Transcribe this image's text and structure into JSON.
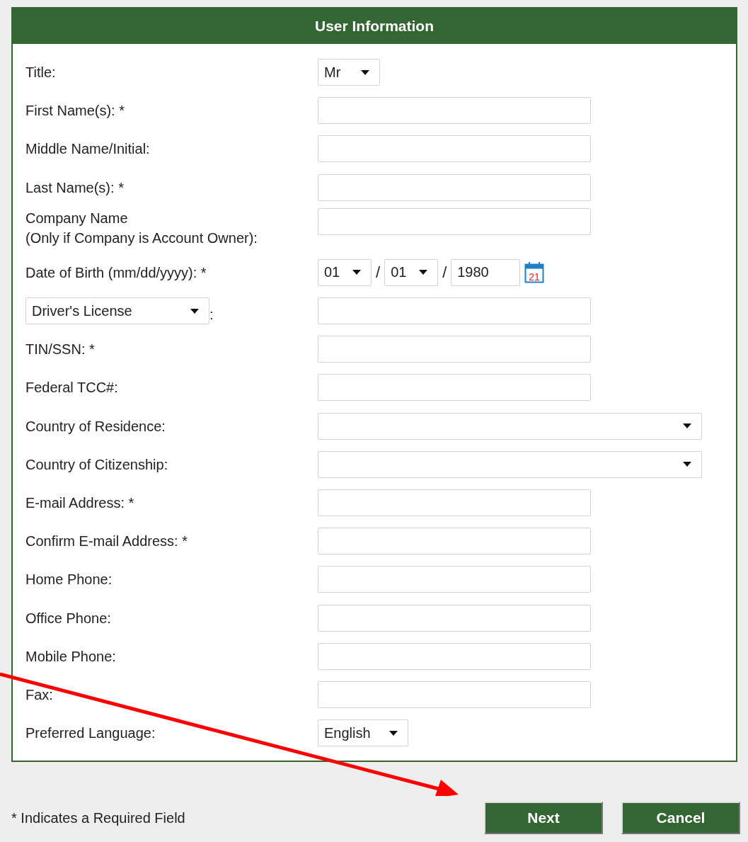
{
  "form": {
    "title": "User Information",
    "rows": [
      {
        "kind": "select",
        "label": "Title:",
        "value": "Mr"
      },
      {
        "kind": "text",
        "label": "First Name(s): *"
      },
      {
        "kind": "text",
        "label": "Middle Name/Initial:"
      },
      {
        "kind": "text",
        "label": "Last Name(s): *"
      },
      {
        "kind": "text",
        "label": "Company Name",
        "note": "(Only if Company is Account Owner):"
      },
      {
        "kind": "date",
        "label": "Date of Birth (mm/dd/yyyy): *",
        "month": "01",
        "day": "01",
        "year": "1980",
        "separators": [
          "/",
          "/"
        ],
        "calendar_day": "21"
      },
      {
        "kind": "id-select",
        "value": "Driver's License",
        "suffix": ":"
      },
      {
        "kind": "text",
        "label": "TIN/SSN: *"
      },
      {
        "kind": "text",
        "label": "Federal TCC#:"
      },
      {
        "kind": "wide-select",
        "label": "Country of Residence:"
      },
      {
        "kind": "wide-select",
        "label": "Country of Citizenship:"
      },
      {
        "kind": "text",
        "label": "E-mail Address: *"
      },
      {
        "kind": "text",
        "label": "Confirm E-mail Address: *"
      },
      {
        "kind": "text",
        "label": "Home Phone:"
      },
      {
        "kind": "text",
        "label": "Office Phone:"
      },
      {
        "kind": "text",
        "label": "Mobile Phone:"
      },
      {
        "kind": "text",
        "label": "Fax:"
      },
      {
        "kind": "select",
        "label": "Preferred Language:",
        "value": "English"
      }
    ]
  },
  "footer": {
    "note": "* Indicates a Required Field",
    "buttons": [
      "Next",
      "Cancel"
    ]
  },
  "annotation": {
    "kind": "arrow"
  }
}
